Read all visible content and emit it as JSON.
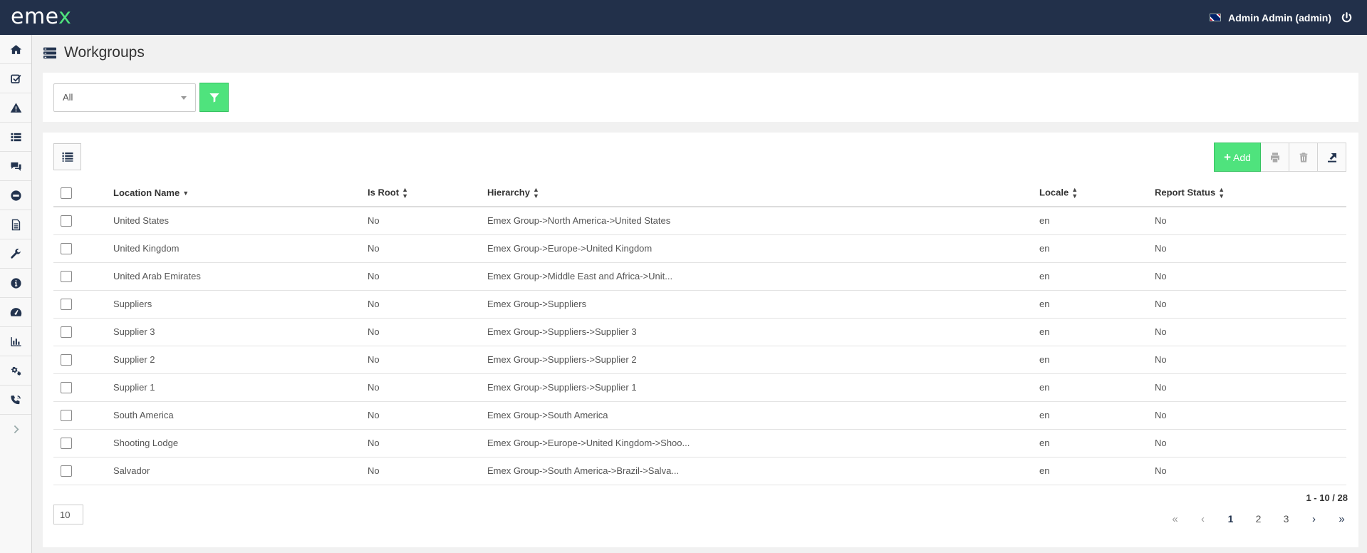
{
  "header": {
    "logo_main": "eme",
    "logo_accent": "x",
    "user_name": "Admin Admin (admin)",
    "power_icon": "power-icon"
  },
  "sidebar": {
    "items": [
      "home-icon",
      "checkbox-icon",
      "warning-icon",
      "list-icon",
      "comments-icon",
      "minus-circle-icon",
      "document-icon",
      "wrench-icon",
      "info-icon",
      "dashboard-icon",
      "bar-chart-icon",
      "cogs-icon",
      "phone-icon",
      "chevron-right-icon"
    ]
  },
  "page": {
    "title": "Workgroups"
  },
  "filter": {
    "selected": "All"
  },
  "toolbar": {
    "add_label": "Add"
  },
  "table": {
    "columns": [
      "Location Name",
      "Is Root",
      "Hierarchy",
      "Locale",
      "Report Status"
    ],
    "rows": [
      {
        "name": "United States",
        "root": "No",
        "hierarchy": "Emex Group->North America->United States",
        "locale": "en",
        "report": "No"
      },
      {
        "name": "United Kingdom",
        "root": "No",
        "hierarchy": "Emex Group->Europe->United Kingdom",
        "locale": "en",
        "report": "No"
      },
      {
        "name": "United Arab Emirates",
        "root": "No",
        "hierarchy": "Emex Group->Middle East and Africa->Unit...",
        "locale": "en",
        "report": "No"
      },
      {
        "name": "Suppliers",
        "root": "No",
        "hierarchy": "Emex Group->Suppliers",
        "locale": "en",
        "report": "No"
      },
      {
        "name": "Supplier 3",
        "root": "No",
        "hierarchy": "Emex Group->Suppliers->Supplier 3",
        "locale": "en",
        "report": "No"
      },
      {
        "name": "Supplier 2",
        "root": "No",
        "hierarchy": "Emex Group->Suppliers->Supplier 2",
        "locale": "en",
        "report": "No"
      },
      {
        "name": "Supplier 1",
        "root": "No",
        "hierarchy": "Emex Group->Suppliers->Supplier 1",
        "locale": "en",
        "report": "No"
      },
      {
        "name": "South America",
        "root": "No",
        "hierarchy": "Emex Group->South America",
        "locale": "en",
        "report": "No"
      },
      {
        "name": "Shooting Lodge",
        "root": "No",
        "hierarchy": "Emex Group->Europe->United Kingdom->Shoo...",
        "locale": "en",
        "report": "No"
      },
      {
        "name": "Salvador",
        "root": "No",
        "hierarchy": "Emex Group->South America->Brazil->Salva...",
        "locale": "en",
        "report": "No"
      }
    ]
  },
  "pagination": {
    "page_size": "10",
    "range": "1 - 10 / 28",
    "pages": [
      "1",
      "2",
      "3"
    ],
    "current": "1"
  }
}
